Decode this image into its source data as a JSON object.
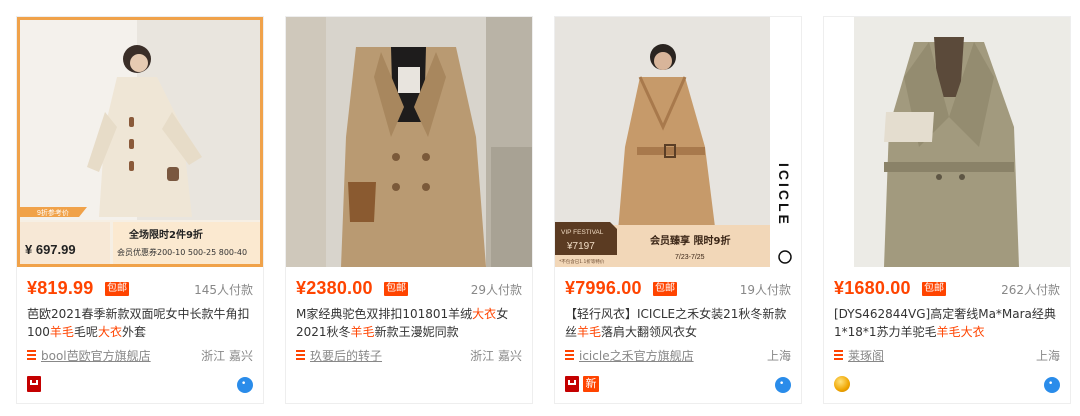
{
  "products": [
    {
      "price": "¥819.99",
      "baoyou": "包邮",
      "sales": "145人付款",
      "title_parts": [
        "芭欧2021春季新款双面呢女中长款牛角扣",
        "100",
        "羊毛",
        "毛呢",
        "大衣",
        "外套"
      ],
      "shop": "bool芭欧官方旗舰店",
      "location": "浙江 嘉兴",
      "overlay": {
        "discount_tag": "9折参考价",
        "promo_price": "¥ 697.99",
        "promo_line1": "全场限时2件9折",
        "promo_line2": "会员优惠券200-10 500-25 800-40"
      }
    },
    {
      "price": "¥2380.00",
      "baoyou": "包邮",
      "sales": "29人付款",
      "title_parts": [
        "M家经典驼色双排扣101801羊绒",
        "大衣",
        "女 2021秋冬",
        "羊毛",
        "新款王漫妮同款"
      ],
      "shop": "玖要后的转子",
      "location": "浙江 嘉兴"
    },
    {
      "price": "¥7996.00",
      "baoyou": "包邮",
      "sales": "19人付款",
      "title_parts": [
        "【轻行风衣】ICICLE之禾女装21秋冬新款 丝",
        "羊毛",
        "落肩大翻领风衣女"
      ],
      "shop": "icicle之禾官方旗舰店",
      "location": "上海",
      "badge_new": "新",
      "overlay": {
        "vip_tag": "VIP FESTIVAL",
        "vip_price": "¥7197",
        "promo_line1": "会员臻享 限时9折",
        "promo_line2": "7/23-7/25",
        "brand": "ICICLE",
        "note": "*不包含已1.1折等特价"
      }
    },
    {
      "price": "¥1680.00",
      "baoyou": "包邮",
      "sales": "262人付款",
      "title_parts": [
        "[DYS462844VG]高定奢线Ma*Mara经典 1*18*1苏力羊驼毛",
        "羊毛",
        "大衣"
      ],
      "shop": "莱琢阁",
      "location": "上海"
    }
  ]
}
